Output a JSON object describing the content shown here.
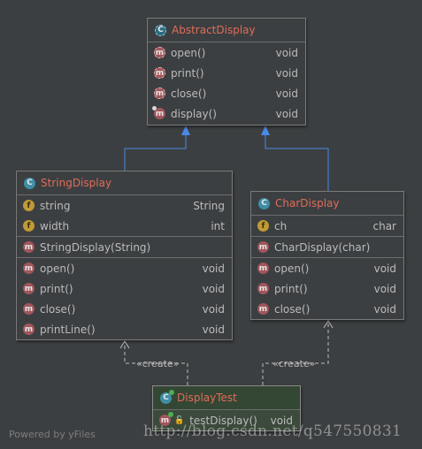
{
  "nodes": {
    "abstract_display": {
      "title": "AbstractDisplay",
      "icon": "abstract-class-icon",
      "methods": [
        {
          "name": "open()",
          "type": "void",
          "icon": "abstract-method-icon"
        },
        {
          "name": "print()",
          "type": "void",
          "icon": "abstract-method-icon"
        },
        {
          "name": "close()",
          "type": "void",
          "icon": "abstract-method-icon"
        },
        {
          "name": "display()",
          "type": "void",
          "icon": "method-icon"
        }
      ]
    },
    "string_display": {
      "title": "StringDisplay",
      "icon": "class-icon",
      "fields": [
        {
          "name": "string",
          "type": "String"
        },
        {
          "name": "width",
          "type": "int"
        }
      ],
      "constructors": [
        {
          "name": "StringDisplay(String)",
          "type": ""
        }
      ],
      "methods": [
        {
          "name": "open()",
          "type": "void"
        },
        {
          "name": "print()",
          "type": "void"
        },
        {
          "name": "close()",
          "type": "void"
        },
        {
          "name": "printLine()",
          "type": "void"
        }
      ]
    },
    "char_display": {
      "title": "CharDisplay",
      "icon": "class-icon",
      "fields": [
        {
          "name": "ch",
          "type": "char"
        }
      ],
      "constructors": [
        {
          "name": "CharDisplay(char)",
          "type": ""
        }
      ],
      "methods": [
        {
          "name": "open()",
          "type": "void"
        },
        {
          "name": "print()",
          "type": "void"
        },
        {
          "name": "close()",
          "type": "void"
        }
      ]
    },
    "display_test": {
      "title": "DisplayTest",
      "icon": "test-class-icon",
      "methods": [
        {
          "name": "testDisplay()",
          "type": "void"
        }
      ]
    }
  },
  "edges": {
    "create_label_left": "«create»",
    "create_label_right": "«create»"
  },
  "footer": {
    "powered_by": "Powered by yFiles",
    "watermark": "http://blog.csdn.net/q547550831"
  },
  "colors": {
    "background": "#3c3f41",
    "title": "#e06c5a",
    "inheritance_arrow": "#4a88e8",
    "dependency_arrow": "#bbbbbb"
  }
}
